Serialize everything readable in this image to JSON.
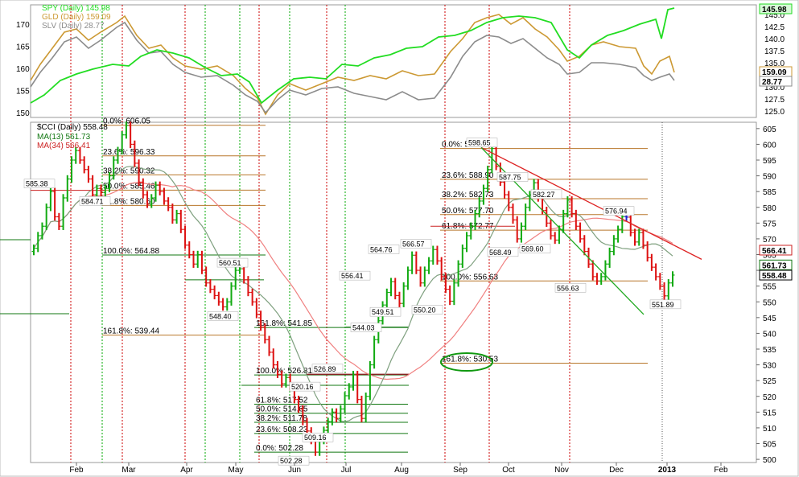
{
  "colors": {
    "spy": "#22dd22",
    "gld": "#cc9933",
    "slv": "#8c8c8c",
    "up": "#11aa11",
    "down": "#dd1111",
    "flat": "#2222cc",
    "ma13": "#7fa07f",
    "ma34": "#f08080",
    "fib_orange": "#b8762a",
    "fib_green": "#117711",
    "fib_red": "#cc2222",
    "trend_red": "#dd2222",
    "trend_green": "#22aa22",
    "vline_red": "#cc0000",
    "vline_green": "#00aa00",
    "highlight": "#119911"
  },
  "top_panel": {
    "legend": [
      {
        "label": "SPY (Daily) 145.98",
        "color": "#22dd22"
      },
      {
        "label": "GLD (Daily) 159.09",
        "color": "#cc9933"
      },
      {
        "label": "SLV (Daily) 28.77",
        "color": "#8c8c8c"
      }
    ],
    "left_ticks": [
      "170",
      "165",
      "160",
      "155",
      "150"
    ],
    "right_ticks": [
      "145.0",
      "142.5",
      "140.0",
      "137.5",
      "135.0",
      "132.5",
      "130.0",
      "127.5",
      "125.0"
    ],
    "last_values": [
      {
        "text": "145.98",
        "color": "#22dd22"
      },
      {
        "text": "159.09",
        "color": "#cc9933"
      },
      {
        "text": "28.77",
        "color": "#8c8c8c"
      }
    ]
  },
  "chart_data": {
    "type": "line",
    "title": "$CCI (Daily) 558.48",
    "x_labels": [
      "Feb",
      "Mar",
      "Apr",
      "May",
      "Jun",
      "Jul",
      "Aug",
      "Sep",
      "Oct",
      "Nov",
      "Dec",
      "2013",
      "Feb"
    ],
    "y_ticks": [
      "605",
      "600",
      "595",
      "590",
      "585",
      "580",
      "575",
      "570",
      "565",
      "560",
      "555",
      "550",
      "545",
      "540",
      "535",
      "530",
      "525",
      "520",
      "515",
      "510",
      "505",
      "500"
    ],
    "ylim": [
      499,
      607
    ],
    "legend": [
      {
        "label": "$CCI (Daily) 558.48",
        "color": "#000000"
      },
      {
        "label": "MA(13) 561.73",
        "color": "#117711"
      },
      {
        "label": "MA(34) 566.41",
        "color": "#cc2222"
      }
    ],
    "series": [
      {
        "name": "$CCI",
        "values": [
          567,
          571,
          574,
          580,
          585,
          577,
          574,
          583,
          589,
          595,
          598,
          595,
          592,
          589,
          584,
          586,
          584.7,
          586,
          590,
          595,
          598,
          603,
          606,
          600,
          594,
          588,
          584,
          581,
          583,
          587,
          585,
          582,
          580,
          576,
          578,
          573,
          568,
          565,
          562,
          565,
          560,
          556,
          554,
          552,
          550,
          548.4,
          550,
          555,
          560,
          560.5,
          557,
          553,
          550,
          546,
          542,
          538,
          534,
          530,
          527,
          524,
          526,
          523,
          519,
          516,
          512,
          509,
          506,
          502.3,
          506,
          509.2,
          512,
          515,
          513,
          516,
          520.2,
          523,
          526.9,
          519,
          513,
          520,
          530,
          538,
          544,
          549,
          553,
          556.4,
          552,
          549.5,
          555,
          560,
          564.8,
          560,
          556,
          560,
          563,
          566.6,
          563,
          558,
          554,
          550.2,
          556,
          562,
          567,
          571,
          574,
          578,
          582,
          586,
          592,
          598.7,
          593,
          588,
          584,
          580,
          576,
          570,
          574,
          580,
          584,
          587.8,
          583,
          579,
          575,
          571,
          569.6,
          573,
          578,
          582.3,
          578,
          574,
          570,
          566,
          562,
          558,
          556.6,
          558,
          562,
          566,
          570,
          573,
          577,
          576.9,
          572,
          569,
          572,
          568,
          564,
          561,
          558,
          555,
          551.9,
          556,
          558.5
        ]
      },
      {
        "name": "MA(13)",
        "values": [
          561.73
        ]
      },
      {
        "name": "MA(34)",
        "values": [
          566.41
        ]
      }
    ],
    "point_labels": [
      {
        "text": "585.38",
        "value": 585.38
      },
      {
        "text": "584.71",
        "value": 584.71
      },
      {
        "text": "560.51",
        "value": 560.51
      },
      {
        "text": "548.40",
        "value": 548.4
      },
      {
        "text": "526.89",
        "value": 526.89
      },
      {
        "text": "520.16",
        "value": 520.16
      },
      {
        "text": "509.16",
        "value": 509.16
      },
      {
        "text": "502.28",
        "value": 502.28
      },
      {
        "text": "556.41",
        "value": 556.41
      },
      {
        "text": "544.03",
        "value": 544.03
      },
      {
        "text": "564.76",
        "value": 564.76
      },
      {
        "text": "549.51",
        "value": 549.51
      },
      {
        "text": "566.57",
        "value": 566.57
      },
      {
        "text": "550.20",
        "value": 550.2
      },
      {
        "text": "598.65",
        "value": 598.65
      },
      {
        "text": "568.49",
        "value": 568.49
      },
      {
        "text": "587.75",
        "value": 587.75
      },
      {
        "text": "569.60",
        "value": 569.6
      },
      {
        "text": "582.27",
        "value": 582.27
      },
      {
        "text": "556.63",
        "value": 556.63
      },
      {
        "text": "576.94",
        "value": 576.94
      },
      {
        "text": "551.89",
        "value": 551.89
      }
    ],
    "fib_sets": [
      {
        "name": "fib-1",
        "levels": [
          {
            "text": "0.0%: 606.05",
            "value": 606.05
          },
          {
            "text": "23.6%: 596.33",
            "value": 596.33
          },
          {
            "text": "38.2%: 590.32",
            "value": 590.32
          },
          {
            "text": "50.0%: 585.46",
            "value": 585.46
          },
          {
            "text": "61.8%: 580.60",
            "value": 580.6
          },
          {
            "text": "100.0%: 564.88",
            "value": 564.88
          },
          {
            "text": "161.8%: 539.44",
            "value": 539.44
          }
        ]
      },
      {
        "name": "fib-2",
        "levels": [
          {
            "text": "161.8%: 541.85",
            "value": 541.85
          },
          {
            "text": "100.0%: 526.81",
            "value": 526.81
          },
          {
            "text": "61.8%: 517.52",
            "value": 517.52
          },
          {
            "text": "50.0%: 514.65",
            "value": 514.65
          },
          {
            "text": "38.2%: 511.78",
            "value": 511.78
          },
          {
            "text": "23.6%: 508.23",
            "value": 508.23
          },
          {
            "text": "0.0%: 502.28",
            "value": 502.28
          }
        ]
      },
      {
        "name": "fib-3",
        "levels": [
          {
            "text": "0.0%: 598.67",
            "value": 598.67
          },
          {
            "text": "23.6%: 588.90",
            "value": 588.9
          },
          {
            "text": "38.2%: 582.73",
            "value": 582.73
          },
          {
            "text": "50.0%: 577.70",
            "value": 577.7
          },
          {
            "text": "61.8%: 572.77",
            "value": 572.77
          },
          {
            "text": "100.0%: 556.63",
            "value": 556.63
          },
          {
            "text": "161.8%: 530.53",
            "value": 530.53
          }
        ]
      }
    ],
    "last_values": [
      {
        "text": "566.41",
        "color": "#cc2222"
      },
      {
        "text": "561.73",
        "color": "#117711"
      },
      {
        "text": "558.48",
        "color": "#000000"
      }
    ]
  }
}
